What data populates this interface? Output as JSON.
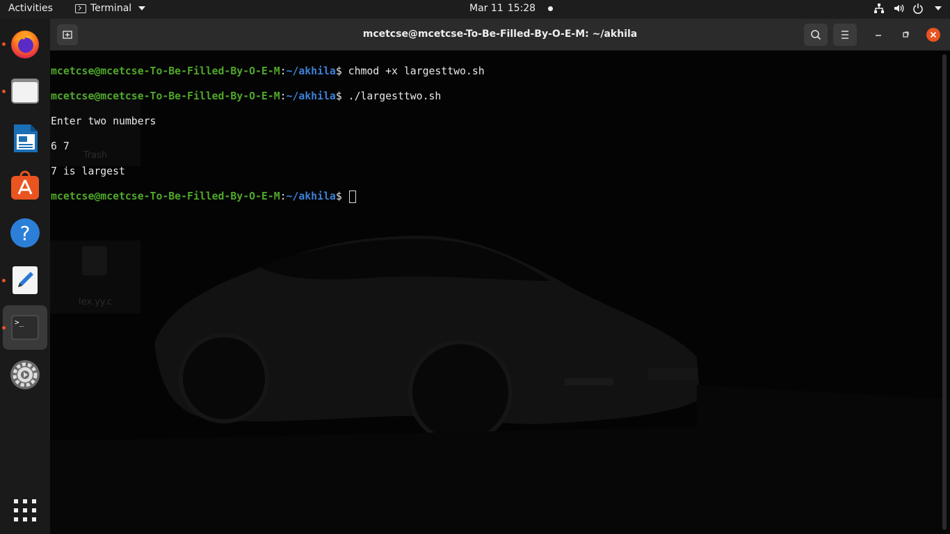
{
  "topbar": {
    "activities": "Activities",
    "app_name": "Terminal",
    "date": "Mar 11",
    "time": "15:28"
  },
  "dock": {
    "items": [
      {
        "name": "Firefox",
        "running": true
      },
      {
        "name": "Files",
        "running": true
      },
      {
        "name": "LibreOffice Writer",
        "running": false
      },
      {
        "name": "Ubuntu Software",
        "running": false
      },
      {
        "name": "Help",
        "running": false
      },
      {
        "name": "Text Editor",
        "running": true
      },
      {
        "name": "Terminal",
        "running": true,
        "active": true
      },
      {
        "name": "Settings",
        "running": false
      },
      {
        "name": "Show Applications",
        "running": false
      }
    ]
  },
  "window": {
    "title": "mcetcse@mcetcse-To-Be-Filled-By-O-E-M: ~/akhila"
  },
  "terminal": {
    "prompt_user": "mcetcse@mcetcse-To-Be-Filled-By-O-E-M",
    "prompt_path": "~/akhila",
    "prompt_symbol": "$",
    "cmd1": "chmod +x largesttwo.sh",
    "cmd2": "./largesttwo.sh",
    "out1": "Enter two numbers",
    "out2": "6 7",
    "out3": "7 is largest"
  },
  "desktop_ghosts": {
    "trash": "Trash",
    "file": "lex.yy.c"
  },
  "colors": {
    "accent": "#e95420",
    "prompt_user": "#4fa82a",
    "prompt_path": "#3d82d8"
  }
}
